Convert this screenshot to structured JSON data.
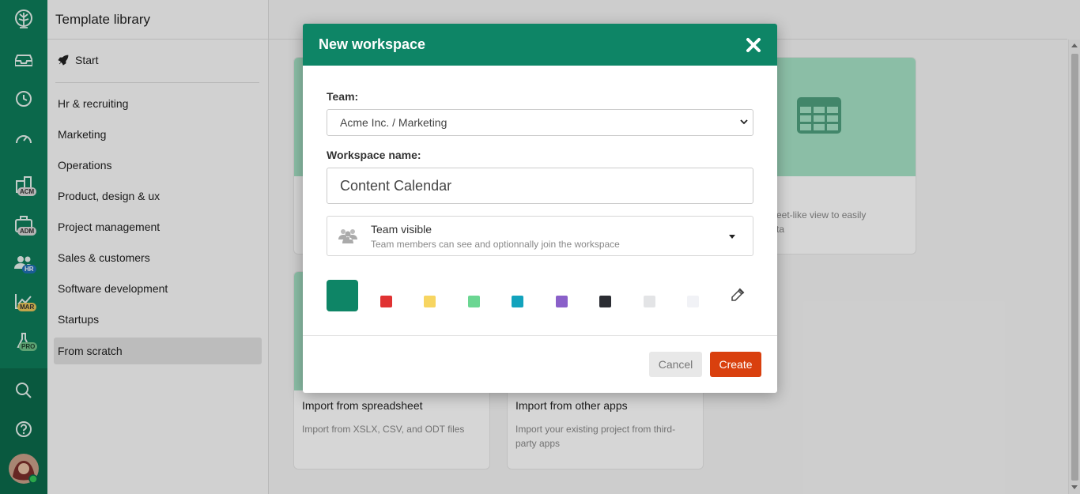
{
  "rail": {
    "badges": {
      "acm": "ACM",
      "adm": "ADM",
      "hr": "HR",
      "mar": "MAR",
      "pro": "PRO"
    }
  },
  "sidebar": {
    "title": "Template library",
    "start_label": "Start",
    "items": [
      {
        "label": "Hr & recruiting"
      },
      {
        "label": "Marketing"
      },
      {
        "label": "Operations"
      },
      {
        "label": "Product, design & ux"
      },
      {
        "label": "Project management"
      },
      {
        "label": "Sales & customers"
      },
      {
        "label": "Software development"
      },
      {
        "label": "Startups"
      },
      {
        "label": "From scratch"
      }
    ]
  },
  "main": {
    "card_right": {
      "desc_line1": "eet-like view to easily",
      "desc_line2": "ta"
    },
    "card_spreadsheet": {
      "title": "Import from spreadsheet",
      "desc": "Import from XSLX, CSV, and ODT files"
    },
    "card_apps": {
      "title": "Import from other apps",
      "desc_line1": "Import your existing project from third-",
      "desc_line2": "party apps"
    }
  },
  "modal": {
    "title": "New workspace",
    "team_label": "Team:",
    "team_value": "Acme Inc. / Marketing",
    "name_label": "Workspace name:",
    "name_value": "Content Calendar",
    "visibility_title": "Team visible",
    "visibility_desc": "Team members can see and optionnally join the workspace",
    "colors": [
      "#0e8566",
      "#e03232",
      "#f7d561",
      "#6bd692",
      "#12a3bd",
      "#8a60c9",
      "#2b2d33",
      "#e3e4e6",
      "#f1f2f6"
    ],
    "cancel_label": "Cancel",
    "create_label": "Create"
  }
}
